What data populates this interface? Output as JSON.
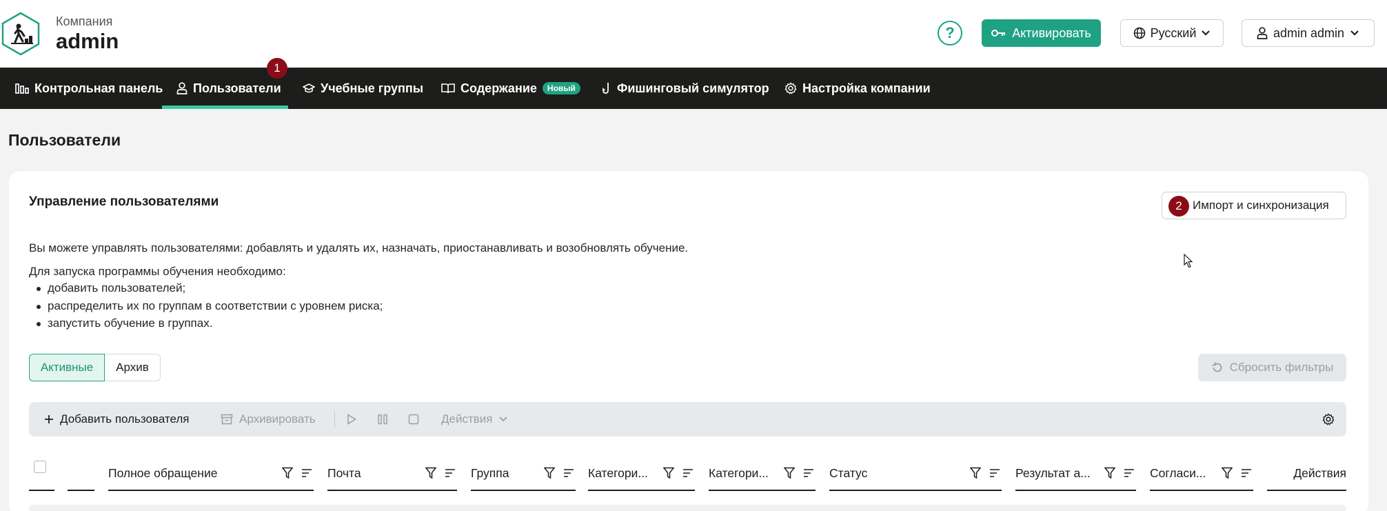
{
  "header": {
    "company_label": "Компания",
    "company_name": "admin",
    "help_label": "?",
    "activate_label": "Активировать",
    "language_label": "Русский",
    "user_label": "admin admin"
  },
  "nav": {
    "items": [
      {
        "label": "Контрольная панель",
        "icon": "bar-chart-icon"
      },
      {
        "label": "Пользователи",
        "icon": "user-icon",
        "active": true
      },
      {
        "label": "Учебные группы",
        "icon": "graduation-cap-icon"
      },
      {
        "label": "Содержание",
        "icon": "book-icon",
        "badge": "Новый"
      },
      {
        "label": "Фишинговый симулятор",
        "icon": "fish-hook-icon"
      },
      {
        "label": "Настройка компании",
        "icon": "gear-icon"
      }
    ],
    "marker_1": "1"
  },
  "page": {
    "title": "Пользователи"
  },
  "card": {
    "title": "Управление пользователями",
    "import_label": "Импорт и синхронизация",
    "marker_2": "2",
    "description": "Вы можете управлять пользователями: добавлять и удалять их, назначать, приостанавливать и возобновлять обучение.",
    "requirements_intro": "Для запуска программы обучения необходимо:",
    "requirements": [
      "добавить пользователей;",
      "распределить их по группам в соответствии с уровнем риска;",
      "запустить обучение в группах."
    ],
    "tabs": {
      "active": "Активные",
      "archive": "Архив"
    },
    "reset_label": "Сбросить фильтры"
  },
  "toolbar": {
    "add_user_label": "Добавить пользователя",
    "archive_label": "Архивировать",
    "actions_label": "Действия"
  },
  "table": {
    "columns": [
      "Полное обращение",
      "Почта",
      "Группа",
      "Категори...",
      "Категори...",
      "Статус",
      "Результат а...",
      "Согласи...",
      "Действия"
    ]
  },
  "colors": {
    "accent": "#1fa283",
    "nav_bg": "#1d1d1b",
    "marker": "#8b0c17",
    "active_tab_bar": "#3cc9a5"
  }
}
